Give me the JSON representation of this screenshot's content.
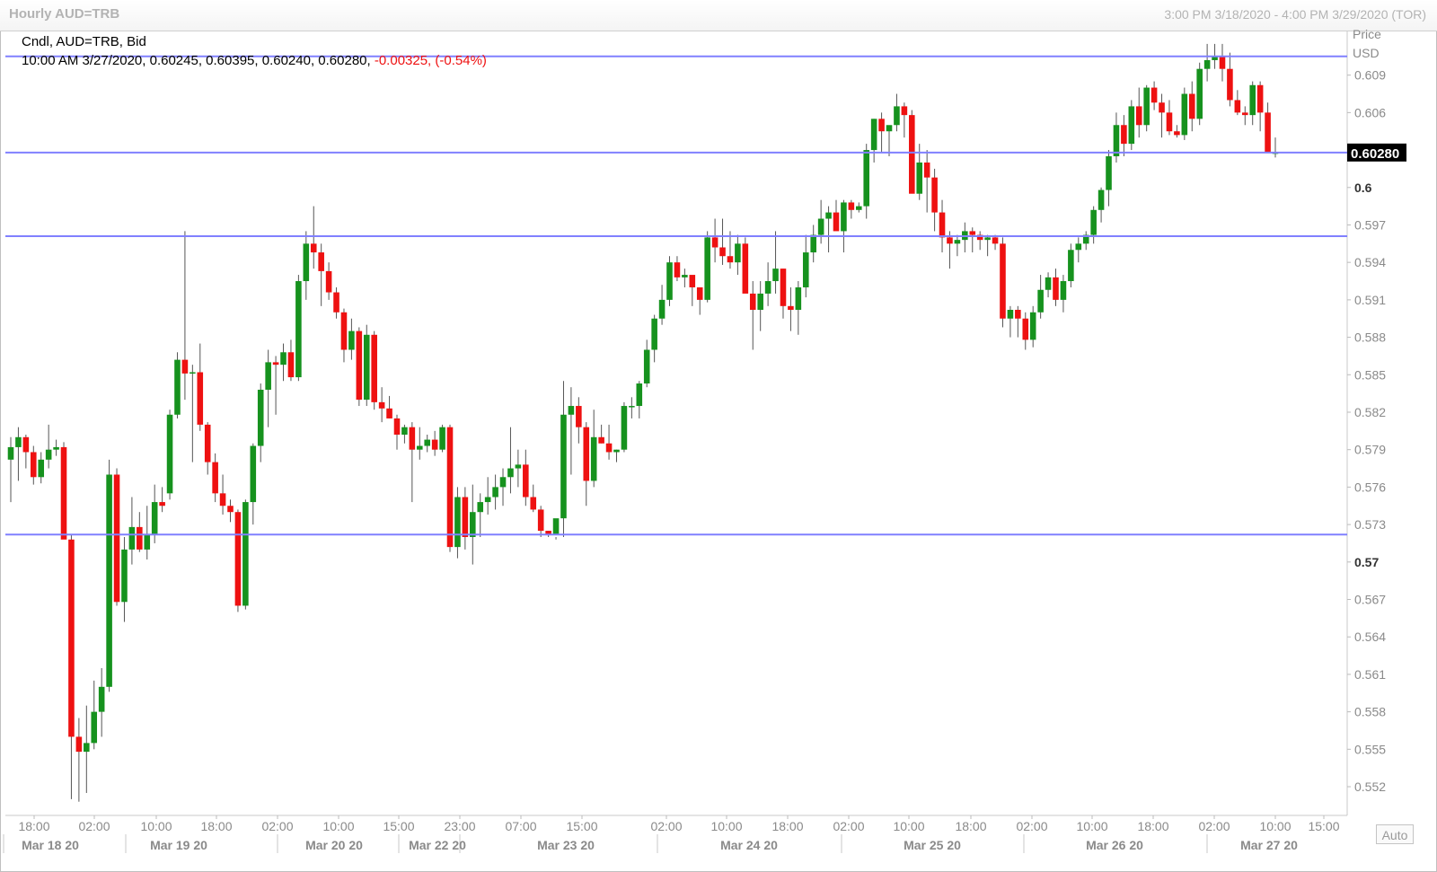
{
  "window": {
    "title": "Hourly AUD=TRB",
    "range": "3:00 PM 3/18/2020 - 4:00 PM 3/29/2020 (TOR)"
  },
  "legend": {
    "name": "Cndl, AUD=TRB, Bid",
    "ohlc": "10:00 AM 3/27/2020, 0.60245, 0.60395, 0.60240, 0.60280,",
    "change": "-0.00325, (-0.54%)"
  },
  "axis": {
    "price_label": "Price",
    "currency_label": "USD",
    "current_price": "0.60280",
    "auto_label": "Auto"
  },
  "colors": {
    "up": "#16921e",
    "down": "#ee1111",
    "hline": "#8080ff",
    "grid": "#e6e6e6"
  },
  "chart_data": {
    "type": "candlestick",
    "title": "Hourly AUD=TRB",
    "ylabel": "Price USD",
    "ylim": [
      0.5497,
      0.6125
    ],
    "y_ticks": [
      "0.609",
      "0.606",
      "0.6",
      "0.597",
      "0.594",
      "0.591",
      "0.588",
      "0.585",
      "0.582",
      "0.579",
      "0.576",
      "0.573",
      "0.57",
      "0.567",
      "0.564",
      "0.561",
      "0.558",
      "0.555",
      "0.552"
    ],
    "y_ticks_bold": [
      "0.6",
      "0.57"
    ],
    "time_ticks": [
      "18:00",
      "02:00",
      "10:00",
      "18:00",
      "02:00",
      "10:00",
      "15:00",
      "23:00",
      "07:00",
      "15:00",
      "02:00",
      "10:00",
      "18:00",
      "02:00",
      "10:00",
      "18:00",
      "02:00",
      "10:00",
      "18:00",
      "02:00",
      "10:00",
      "15:00"
    ],
    "date_labels": [
      "Mar 18 20",
      "Mar 19 20",
      "Mar 20 20",
      "Mar 22 20",
      "Mar 23 20",
      "Mar 24 20",
      "Mar 25 20",
      "Mar 26 20",
      "Mar 27 20"
    ],
    "horizontal_lines": [
      0.6105,
      0.6028,
      0.5961,
      0.5722
    ],
    "candles": [
      [
        0.5782,
        0.58,
        0.5748,
        0.5792
      ],
      [
        0.5792,
        0.5808,
        0.5765,
        0.58
      ],
      [
        0.58,
        0.5802,
        0.5775,
        0.5788
      ],
      [
        0.5788,
        0.5793,
        0.5762,
        0.5768
      ],
      [
        0.5768,
        0.5788,
        0.5763,
        0.5782
      ],
      [
        0.5782,
        0.581,
        0.5775,
        0.579
      ],
      [
        0.579,
        0.5798,
        0.5785,
        0.5792
      ],
      [
        0.5792,
        0.5796,
        0.572,
        0.5718
      ],
      [
        0.5718,
        0.5722,
        0.551,
        0.556
      ],
      [
        0.556,
        0.5575,
        0.5508,
        0.5548
      ],
      [
        0.5548,
        0.5585,
        0.5515,
        0.5555
      ],
      [
        0.5555,
        0.5605,
        0.555,
        0.558
      ],
      [
        0.558,
        0.5615,
        0.556,
        0.56
      ],
      [
        0.56,
        0.5782,
        0.5596,
        0.577
      ],
      [
        0.577,
        0.5775,
        0.5665,
        0.5668
      ],
      [
        0.5668,
        0.572,
        0.5652,
        0.571
      ],
      [
        0.571,
        0.5752,
        0.5698,
        0.5728
      ],
      [
        0.5728,
        0.574,
        0.5708,
        0.571
      ],
      [
        0.571,
        0.5745,
        0.5702,
        0.5722
      ],
      [
        0.5722,
        0.5762,
        0.5715,
        0.5748
      ],
      [
        0.5748,
        0.576,
        0.574,
        0.5745
      ],
      [
        0.5755,
        0.5822,
        0.575,
        0.5818
      ],
      [
        0.5818,
        0.5868,
        0.5815,
        0.5862
      ],
      [
        0.5862,
        0.5965,
        0.583,
        0.5851
      ],
      [
        0.5851,
        0.5858,
        0.578,
        0.5852
      ],
      [
        0.5852,
        0.5875,
        0.5805,
        0.581
      ],
      [
        0.581,
        0.5812,
        0.577,
        0.578
      ],
      [
        0.578,
        0.5787,
        0.5748,
        0.5755
      ],
      [
        0.5755,
        0.577,
        0.5738,
        0.5745
      ],
      [
        0.5745,
        0.575,
        0.5732,
        0.574
      ],
      [
        0.574,
        0.5742,
        0.566,
        0.5665
      ],
      [
        0.5665,
        0.575,
        0.5662,
        0.5748
      ],
      [
        0.5748,
        0.5795,
        0.573,
        0.5793
      ],
      [
        0.5793,
        0.5843,
        0.578,
        0.5838
      ],
      [
        0.5838,
        0.587,
        0.5808,
        0.586
      ],
      [
        0.586,
        0.5865,
        0.5818,
        0.5858
      ],
      [
        0.5858,
        0.5875,
        0.5845,
        0.5868
      ],
      [
        0.5868,
        0.5878,
        0.5845,
        0.5848
      ],
      [
        0.5848,
        0.593,
        0.5845,
        0.5925
      ],
      [
        0.5925,
        0.5965,
        0.591,
        0.5955
      ],
      [
        0.5955,
        0.5985,
        0.5935,
        0.5948
      ],
      [
        0.5948,
        0.5955,
        0.5905,
        0.5933
      ],
      [
        0.5933,
        0.594,
        0.591,
        0.5916
      ],
      [
        0.5916,
        0.592,
        0.5895,
        0.59
      ],
      [
        0.59,
        0.5903,
        0.586,
        0.587
      ],
      [
        0.587,
        0.5895,
        0.5862,
        0.5885
      ],
      [
        0.5885,
        0.5888,
        0.5825,
        0.583
      ],
      [
        0.583,
        0.589,
        0.5825,
        0.5882
      ],
      [
        0.5882,
        0.5885,
        0.5822,
        0.5828
      ],
      [
        0.5828,
        0.584,
        0.5812,
        0.5823
      ],
      [
        0.5823,
        0.5833,
        0.5815,
        0.5815
      ],
      [
        0.5815,
        0.5818,
        0.579,
        0.5802
      ],
      [
        0.5802,
        0.581,
        0.5795,
        0.5808
      ],
      [
        0.5808,
        0.5812,
        0.5748,
        0.579
      ],
      [
        0.579,
        0.5808,
        0.5782,
        0.5793
      ],
      [
        0.5793,
        0.5802,
        0.5788,
        0.5798
      ],
      [
        0.5798,
        0.5805,
        0.5785,
        0.579
      ],
      [
        0.579,
        0.581,
        0.5788,
        0.5808
      ],
      [
        0.5808,
        0.581,
        0.5708,
        0.5712
      ],
      [
        0.5712,
        0.576,
        0.5703,
        0.5752
      ],
      [
        0.5752,
        0.576,
        0.571,
        0.572
      ],
      [
        0.572,
        0.5762,
        0.5698,
        0.574
      ],
      [
        0.574,
        0.5755,
        0.572,
        0.5748
      ],
      [
        0.5748,
        0.5768,
        0.5738,
        0.5752
      ],
      [
        0.5752,
        0.577,
        0.5742,
        0.576
      ],
      [
        0.576,
        0.5775,
        0.5745,
        0.5768
      ],
      [
        0.5768,
        0.5808,
        0.5755,
        0.5775
      ],
      [
        0.5775,
        0.579,
        0.576,
        0.5778
      ],
      [
        0.5778,
        0.579,
        0.5745,
        0.5752
      ],
      [
        0.5752,
        0.5762,
        0.574,
        0.5742
      ],
      [
        0.5742,
        0.5745,
        0.572,
        0.5725
      ],
      [
        0.5725,
        0.5725,
        0.572,
        0.5722
      ],
      [
        0.5722,
        0.5718,
        0.572,
        0.5735
      ],
      [
        0.5735,
        0.5845,
        0.572,
        0.5818
      ],
      [
        0.5818,
        0.584,
        0.577,
        0.5825
      ],
      [
        0.5825,
        0.5832,
        0.5795,
        0.5808
      ],
      [
        0.5808,
        0.5812,
        0.5745,
        0.5765
      ],
      [
        0.5765,
        0.5822,
        0.576,
        0.58
      ],
      [
        0.58,
        0.581,
        0.5795,
        0.5795
      ],
      [
        0.5795,
        0.581,
        0.5782,
        0.5788
      ],
      [
        0.5788,
        0.579,
        0.578,
        0.579
      ],
      [
        0.579,
        0.5828,
        0.5788,
        0.5825
      ],
      [
        0.5825,
        0.5832,
        0.5815,
        0.5825
      ],
      [
        0.5825,
        0.5845,
        0.5815,
        0.5843
      ],
      [
        0.5843,
        0.5878,
        0.584,
        0.587
      ],
      [
        0.587,
        0.5898,
        0.586,
        0.5895
      ],
      [
        0.5895,
        0.5922,
        0.589,
        0.591
      ],
      [
        0.591,
        0.5945,
        0.5905,
        0.594
      ],
      [
        0.594,
        0.5945,
        0.5925,
        0.5928
      ],
      [
        0.5928,
        0.5935,
        0.592,
        0.593
      ],
      [
        0.593,
        0.5922,
        0.5905,
        0.592
      ],
      [
        0.592,
        0.5915,
        0.5898,
        0.591
      ],
      [
        0.591,
        0.5965,
        0.5908,
        0.596
      ],
      [
        0.596,
        0.5975,
        0.594,
        0.5952
      ],
      [
        0.5952,
        0.5975,
        0.5938,
        0.5945
      ],
      [
        0.5945,
        0.5965,
        0.5935,
        0.594
      ],
      [
        0.594,
        0.5962,
        0.593,
        0.5955
      ],
      [
        0.5955,
        0.596,
        0.5935,
        0.5915
      ],
      [
        0.5915,
        0.5925,
        0.587,
        0.5902
      ],
      [
        0.5902,
        0.5925,
        0.5885,
        0.5915
      ],
      [
        0.5915,
        0.594,
        0.5905,
        0.5925
      ],
      [
        0.5925,
        0.5965,
        0.5915,
        0.5935
      ],
      [
        0.5935,
        0.5935,
        0.5895,
        0.5905
      ],
      [
        0.5905,
        0.592,
        0.5885,
        0.5902
      ],
      [
        0.5902,
        0.5925,
        0.5882,
        0.592
      ],
      [
        0.592,
        0.5962,
        0.5912,
        0.5948
      ],
      [
        0.5948,
        0.597,
        0.594,
        0.5962
      ],
      [
        0.5962,
        0.599,
        0.5955,
        0.5975
      ],
      [
        0.5975,
        0.5985,
        0.5948,
        0.598
      ],
      [
        0.598,
        0.599,
        0.5968,
        0.5965
      ],
      [
        0.5965,
        0.599,
        0.5948,
        0.5988
      ],
      [
        0.5988,
        0.599,
        0.5975,
        0.5982
      ],
      [
        0.5982,
        0.5988,
        0.598,
        0.5985
      ],
      [
        0.5985,
        0.6035,
        0.5975,
        0.603
      ],
      [
        0.603,
        0.6055,
        0.602,
        0.6055
      ],
      [
        0.6055,
        0.606,
        0.6028,
        0.6045
      ],
      [
        0.6045,
        0.6048,
        0.6025,
        0.605
      ],
      [
        0.605,
        0.6075,
        0.6045,
        0.6065
      ],
      [
        0.6065,
        0.6068,
        0.604,
        0.6058
      ],
      [
        0.6058,
        0.6062,
        0.601,
        0.5995
      ],
      [
        0.5995,
        0.6035,
        0.599,
        0.602
      ],
      [
        0.602,
        0.603,
        0.598,
        0.6008
      ],
      [
        0.6008,
        0.6015,
        0.5965,
        0.598
      ],
      [
        0.598,
        0.599,
        0.5948,
        0.596
      ],
      [
        0.596,
        0.5965,
        0.5935,
        0.5955
      ],
      [
        0.5955,
        0.5962,
        0.5945,
        0.5958
      ],
      [
        0.5958,
        0.5972,
        0.5948,
        0.5965
      ],
      [
        0.5965,
        0.5968,
        0.5948,
        0.5962
      ],
      [
        0.5962,
        0.5965,
        0.595,
        0.5958
      ],
      [
        0.5958,
        0.5962,
        0.5945,
        0.596
      ],
      [
        0.596,
        0.5962,
        0.595,
        0.5955
      ],
      [
        0.5955,
        0.596,
        0.5888,
        0.5895
      ],
      [
        0.5895,
        0.5905,
        0.588,
        0.5902
      ],
      [
        0.5902,
        0.5905,
        0.588,
        0.5895
      ],
      [
        0.5895,
        0.59,
        0.587,
        0.5878
      ],
      [
        0.5878,
        0.5905,
        0.5872,
        0.59
      ],
      [
        0.59,
        0.593,
        0.5895,
        0.5918
      ],
      [
        0.5918,
        0.5932,
        0.5912,
        0.5928
      ],
      [
        0.5928,
        0.5935,
        0.5905,
        0.591
      ],
      [
        0.591,
        0.593,
        0.59,
        0.5925
      ],
      [
        0.5925,
        0.5955,
        0.592,
        0.595
      ],
      [
        0.595,
        0.596,
        0.594,
        0.5955
      ],
      [
        0.5955,
        0.5965,
        0.595,
        0.5962
      ],
      [
        0.5962,
        0.5985,
        0.5955,
        0.5982
      ],
      [
        0.5982,
        0.6,
        0.5972,
        0.5998
      ],
      [
        0.5998,
        0.603,
        0.5985,
        0.6025
      ],
      [
        0.6025,
        0.606,
        0.602,
        0.605
      ],
      [
        0.605,
        0.6058,
        0.6025,
        0.6035
      ],
      [
        0.6035,
        0.607,
        0.603,
        0.6065
      ],
      [
        0.6065,
        0.608,
        0.604,
        0.605
      ],
      [
        0.605,
        0.6082,
        0.6045,
        0.608
      ],
      [
        0.608,
        0.6085,
        0.6062,
        0.6068
      ],
      [
        0.6068,
        0.6075,
        0.604,
        0.606
      ],
      [
        0.606,
        0.607,
        0.6042,
        0.6045
      ],
      [
        0.6045,
        0.605,
        0.604,
        0.6042
      ],
      [
        0.6042,
        0.608,
        0.6038,
        0.6075
      ],
      [
        0.6075,
        0.6085,
        0.6045,
        0.6055
      ],
      [
        0.6055,
        0.61,
        0.605,
        0.6095
      ],
      [
        0.6095,
        0.6115,
        0.6085,
        0.6102
      ],
      [
        0.6102,
        0.6115,
        0.6095,
        0.6105
      ],
      [
        0.6105,
        0.6115,
        0.6085,
        0.6095
      ],
      [
        0.6095,
        0.6108,
        0.6065,
        0.607
      ],
      [
        0.607,
        0.6078,
        0.6058,
        0.606
      ],
      [
        0.606,
        0.6065,
        0.605,
        0.6058
      ],
      [
        0.6058,
        0.6085,
        0.605,
        0.6082
      ],
      [
        0.6082,
        0.6085,
        0.6045,
        0.606
      ],
      [
        0.606,
        0.6068,
        0.604,
        0.6028
      ],
      [
        0.6028,
        0.604,
        0.6024,
        0.6028
      ]
    ]
  }
}
